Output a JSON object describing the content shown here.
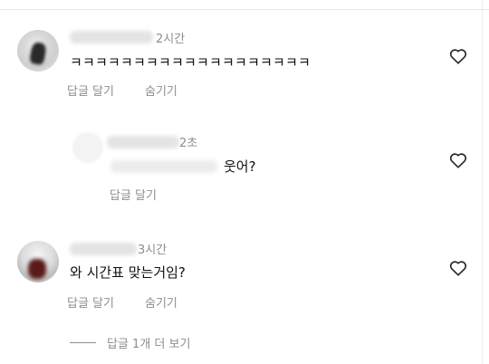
{
  "comments": [
    {
      "time": "2시간",
      "text": "ㅋㅋㅋㅋㅋㅋㅋㅋㅋㅋㅋㅋㅋㅋㅋㅋㅋㅋㅋ",
      "reply_label": "답글 달기",
      "hide_label": "숨기기"
    },
    {
      "time": "2초",
      "text": "웃어?",
      "reply_label": "답글 달기"
    },
    {
      "time": "3시간",
      "text": "와 시간표 맞는거임?",
      "reply_label": "답글 달기",
      "hide_label": "숨기기"
    }
  ],
  "view_replies_label": "답글 1개 더 보기",
  "icons": {
    "like": "heart-outline-icon"
  }
}
